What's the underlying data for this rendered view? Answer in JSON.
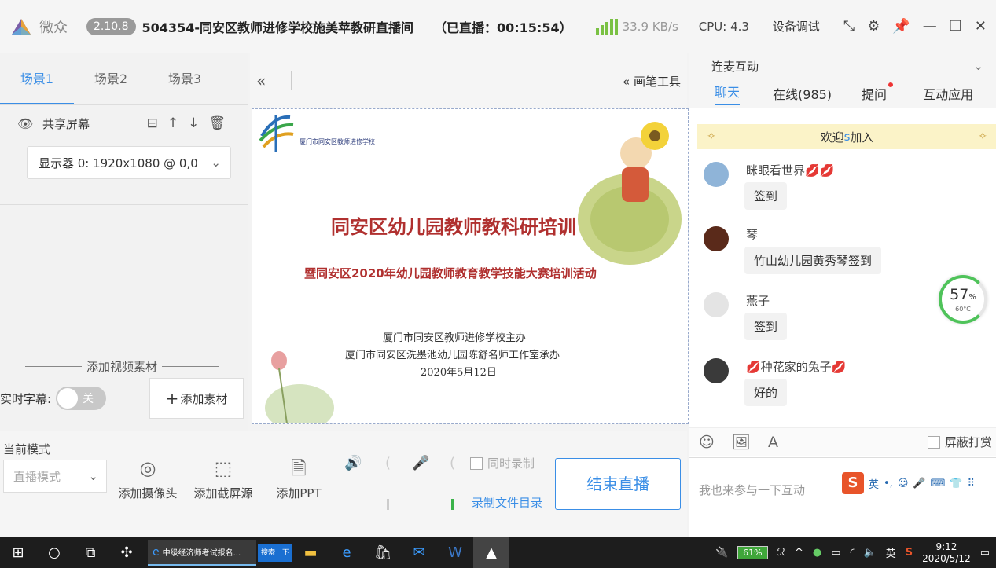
{
  "titlebar": {
    "app_name": "微众",
    "version": "2.10.8",
    "room_title": "504354-同安区教师进修学校施美苹教研直播间",
    "live_time": "（已直播：00:15:54）",
    "net_speed": "33.9 KB/s",
    "cpu": "CPU: 4.3",
    "device_debug": "设备调试"
  },
  "scenes": {
    "tabs": [
      "场景1",
      "场景2",
      "场景3"
    ],
    "source_name": "共享屏幕",
    "display_option": "显示器 0: 1920x1080 @ 0,0"
  },
  "materials": {
    "title": "添加视频素材",
    "subtitle_label": "实时字幕:",
    "subtitle_toggle": "关",
    "add_button": "添加素材"
  },
  "preview": {
    "pen_tool": "画笔工具",
    "slide": {
      "school_name": "厦门市同安区教师进修学校",
      "title": "同安区幼儿园教师教科研培训",
      "subtitle": "暨同安区2020年幼儿园教师教育教学技能大赛培训活动",
      "organizer1": "厦门市同安区教师进修学校主办",
      "organizer2": "厦门市同安区洗墨池幼儿园陈舒名师工作室承办",
      "date": "2020年5月12日"
    }
  },
  "controls": {
    "mode_label": "当前模式",
    "mode_value": "直播模式",
    "add_camera": "添加摄像头",
    "add_capture": "添加截屏源",
    "add_ppt": "添加PPT",
    "sync_record": "同时录制",
    "record_dir": "录制文件目录",
    "end_live": "结束直播"
  },
  "chat": {
    "link_mic": "连麦互动",
    "tabs": [
      "聊天",
      "在线(985)",
      "提问",
      "互动应用"
    ],
    "welcome_prefix": "欢迎",
    "welcome_name": "s",
    "welcome_suffix": "加入",
    "messages": [
      {
        "user": "眯眼看世界💋💋",
        "text": "签到"
      },
      {
        "user": "琴",
        "text": "竹山幼儿园黄秀琴签到"
      },
      {
        "user": "燕子",
        "text": "签到"
      },
      {
        "user": "💋种花家的兔子💋",
        "text": "好的"
      }
    ],
    "block_reward": "屏蔽打赏",
    "input_placeholder": "我也来参与一下互动",
    "ime_lang": "英"
  },
  "cpu_gauge": {
    "percent": "57",
    "unit": "%",
    "temp": "60°C"
  },
  "taskbar": {
    "browser_title": "中级经济师考试报名...",
    "search_label": "搜索一下",
    "battery": "61%",
    "ime": "英",
    "time": "9:12",
    "date": "2020/5/12"
  }
}
